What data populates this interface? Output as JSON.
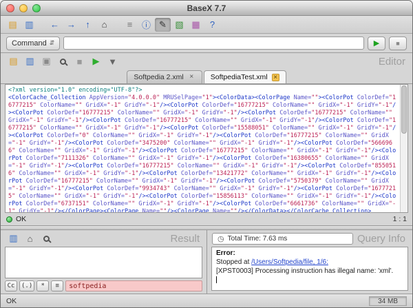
{
  "window": {
    "title": "BaseX 7.7",
    "status_left": "OK",
    "memory": "34 MB"
  },
  "command_bar": {
    "label": "Command",
    "input_value": "",
    "run_glyph": "▶",
    "stop_glyph": "■"
  },
  "toolbar": {
    "icons": [
      {
        "name": "new-database-icon",
        "glyph": "▤",
        "color": "#d79b28"
      },
      {
        "name": "open-database-icon",
        "glyph": "▥",
        "color": "#3a6fc4"
      },
      {
        "sep": true
      },
      {
        "name": "back-icon",
        "glyph": "←",
        "color": "#2f62c0"
      },
      {
        "name": "forward-icon",
        "glyph": "→",
        "color": "#2f62c0"
      },
      {
        "name": "up-icon",
        "glyph": "↑",
        "color": "#2f62c0"
      },
      {
        "name": "home-icon",
        "glyph": "⌂",
        "color": "#444444"
      },
      {
        "sep": true
      },
      {
        "name": "text-view-icon",
        "glyph": "≡",
        "color": "#777777"
      },
      {
        "name": "info-view-icon",
        "glyph": "ⓘ",
        "color": "#2f62c0"
      },
      {
        "name": "editor-view-icon",
        "glyph": "✎",
        "color": "#333333",
        "pressed": true
      },
      {
        "name": "tree-view-icon",
        "glyph": "▧",
        "color": "#3a8f3a"
      },
      {
        "name": "map-view-icon",
        "glyph": "▦",
        "color": "#a855a8"
      },
      {
        "name": "help-icon",
        "glyph": "?",
        "color": "#2f62c0"
      }
    ]
  },
  "editor": {
    "panel_label": "Editor",
    "toolbar_icons": [
      {
        "name": "new-file-icon",
        "glyph": "▤",
        "color": "#d79b28"
      },
      {
        "name": "save-file-icon",
        "glyph": "▥",
        "color": "#3a6fc4"
      },
      {
        "name": "open-file-icon",
        "glyph": "▣",
        "color": "#8a8a8a"
      },
      {
        "name": "search-icon",
        "cls": "mag"
      },
      {
        "name": "stop-icon",
        "glyph": "■",
        "color": "#9a9a9a"
      },
      {
        "name": "run-icon",
        "glyph": "▶",
        "color": "#2fae2f"
      },
      {
        "name": "filter-icon",
        "glyph": "▼",
        "color": "#666666"
      }
    ],
    "tabs": [
      {
        "label": "Softpedia 2.xml",
        "active": false
      },
      {
        "label": "SoftpediaTest.xml",
        "active": true
      }
    ],
    "status_ok": "OK",
    "caret_pos": "1 : 1",
    "content": "<?xml version=\"1.0\" encoding=\"UTF-8\"?>\n<ColorCache_Collection AppVersion=\"4.0.0.0\" MRUSelPage=\"1\"><ColorData><ColorPage Name=\"\"><ColorPot ColorDef=\"16777215\" ColorName=\"\" GridX=\"-1\" GridY=\"-1\"/><ColorPot ColorDef=\"16777215\" ColorName=\"\" GridX=\"-1\" GridY=\"-1\"/><ColorPot ColorDef=\"16777215\" ColorName=\"\" GridX=\"-1\" GridY=\"-1\"/><ColorPot ColorDef=\"16777215\" ColorName=\"\" GridX=\"-1\" GridY=\"-1\"/><ColorPot ColorDef=\"16777215\" ColorName=\"\" GridX=\"-1\" GridY=\"-1\"/><ColorPot ColorDef=\"16777215\" ColorName=\"\" GridX=\"-1\" GridY=\"-1\"/><ColorPot ColorDef=\"15588051\" ColorName=\"\" GridX=\"-1\" GridY=\"-1\"/><ColorPot ColorDef=\"0\" ColorName=\"\" GridX=\"-1\" GridY=\"-1\"/><ColorPot ColorDef=\"16777215\" ColorName=\"\" GridX=\"-1\" GridY=\"-1\"/><ColorPot ColorDef=\"3475200\" ColorName=\"\" GridX=\"-1\" GridY=\"-1\"/><ColorPot ColorDef=\"5666966\" ColorName=\"\" GridX=\"-1\" GridY=\"-1\"/><ColorPot ColorDef=\"16777215\" ColorName=\"\" GridX=\"-1\" GridY=\"-1\"/><ColorPot ColorDef=\"7111326\" ColorName=\"\" GridX=\"-1\" GridY=\"-1\"/><ColorPot ColorDef=\"16380655\" ColorName=\"\" GridX=\"-1\" GridY=\"-1\"/><ColorPot ColorDef=\"16777215\" ColorName=\"\" GridX=\"-1\" GridY=\"-1\"/><ColorPot ColorDef=\"8550516\" ColorName=\"\" GridX=\"-1\" GridY=\"-1\"/><ColorPot ColorDef=\"13421772\" ColorName=\"\" GridX=\"-1\" GridY=\"-1\"/><ColorPot ColorDef=\"16777215\" ColorName=\"\" GridX=\"-1\" GridY=\"-1\"/><ColorPot ColorDef=\"5750379\" ColorName=\"\" GridX=\"-1\" GridY=\"-1\"/><ColorPot ColorDef=\"9934743\" ColorName=\"\" GridX=\"-1\" GridY=\"-1\"/><ColorPot ColorDef=\"16777215\" ColorName=\"\" GridX=\"-1\" GridY=\"-1\"/><ColorPot ColorDef=\"15856113\" ColorName=\"\" GridX=\"-1\" GridY=\"-1\"/><ColorPot ColorDef=\"6737151\" ColorName=\"\" GridX=\"-1\" GridY=\"-1\"/><ColorPot ColorDef=\"6661736\" ColorName=\"\" GridX=\"-1\" GridY=\"-1\"/></ColorPage><ColorPage Name=\"\"/><ColorPage Name=\"\"/></ColorData></ColorCache_Collection>"
  },
  "result": {
    "panel_label": "Result",
    "toolbar_icons": [
      {
        "name": "save-result-icon",
        "glyph": "▥",
        "color": "#3a6fc4"
      },
      {
        "name": "home-icon",
        "glyph": "⌂",
        "color": "#555555"
      },
      {
        "name": "search-icon",
        "cls": "mag"
      }
    ],
    "search": {
      "buttons": [
        {
          "name": "match-case-button",
          "label": "Cc"
        },
        {
          "name": "whole-word-button",
          "label": "(.)"
        },
        {
          "name": "regex-button",
          "label": "*"
        },
        {
          "name": "multiline-button",
          "label": "≡"
        }
      ],
      "value": "softpedia"
    }
  },
  "query_info": {
    "panel_label": "Query Info",
    "total_time": "Total Time: 7.63 ms",
    "error_label": "Error:",
    "stopped_prefix": "Stopped at ",
    "stopped_link": "/Users/Softpedia/file, 1/6:",
    "message": "[XPST0003] Processing instruction has illegal name: 'xml'."
  },
  "colors": {
    "accent_green": "#2fae2f",
    "error_pink": "#f8c9c9",
    "link_blue": "#2244cc",
    "xml_tag_blue": "#1a35c8",
    "xml_value_red": "#bb2255",
    "traffic_red": "#ff5f57",
    "traffic_yellow": "#febc2e",
    "traffic_green": "#28c840"
  }
}
